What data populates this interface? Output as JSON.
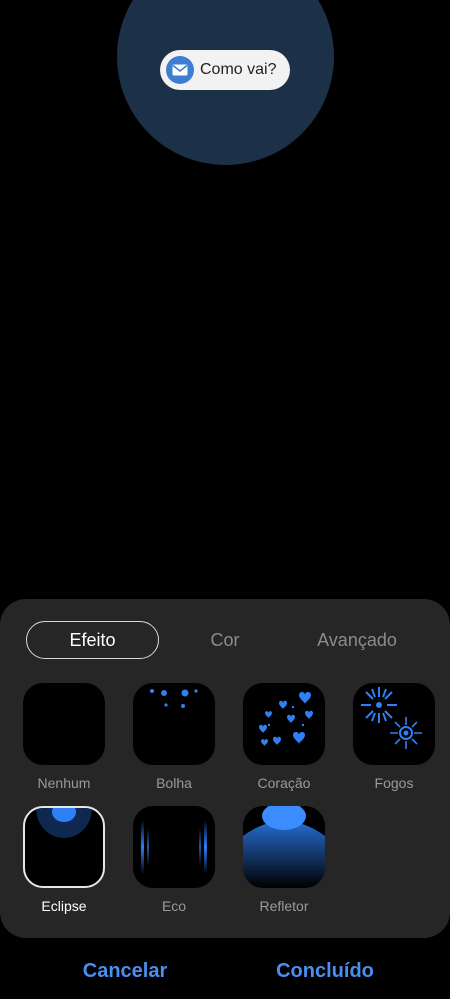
{
  "preview": {
    "notification_text": "Como vai?",
    "icon": "mail-icon"
  },
  "tabs": [
    {
      "label": "Efeito",
      "active": true
    },
    {
      "label": "Cor",
      "active": false
    },
    {
      "label": "Avançado",
      "active": false
    }
  ],
  "effects": [
    {
      "label": "Nenhum"
    },
    {
      "label": "Bolha"
    },
    {
      "label": "Coração"
    },
    {
      "label": "Fogos"
    },
    {
      "label": "Eclipse",
      "selected": true
    },
    {
      "label": "Eco"
    },
    {
      "label": "Refletor"
    }
  ],
  "buttons": {
    "cancel": "Cancelar",
    "done": "Concluído"
  },
  "colors": {
    "accent": "#4a8ef0",
    "effect_blue": "#2f7ff5",
    "panel": "#262626"
  }
}
